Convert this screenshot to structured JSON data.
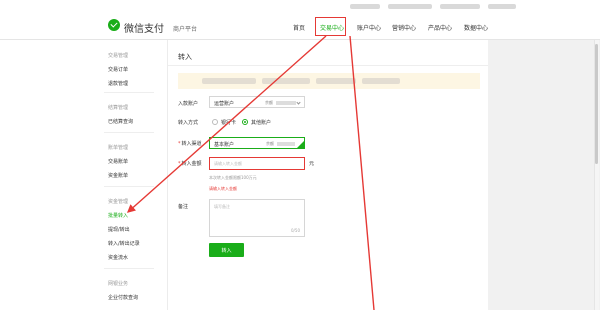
{
  "header": {
    "brand": "微信支付",
    "merchant": "商户平台",
    "nav": [
      {
        "label": "首页",
        "active": false
      },
      {
        "label": "交易中心",
        "active": true
      },
      {
        "label": "账户中心",
        "active": false
      },
      {
        "label": "营销中心",
        "active": false
      },
      {
        "label": "产品中心",
        "active": false
      },
      {
        "label": "数据中心",
        "active": false
      }
    ]
  },
  "sidebar": {
    "groups": [
      {
        "title": "交易管理",
        "items": [
          "交易订单",
          "退款管理"
        ]
      },
      {
        "title": "结算管理",
        "items": [
          "已结算查询"
        ]
      },
      {
        "title": "账单管理",
        "items": [
          "交易账单",
          "资金账单"
        ]
      },
      {
        "title": "资金管理",
        "items": [
          "批量转入",
          "提现/转出",
          "转入/转出记录",
          "资金流水"
        ]
      },
      {
        "title": "网银业务",
        "items": [
          "企业付款查询"
        ]
      }
    ],
    "active_item": "批量转入"
  },
  "form": {
    "page_title": "转入",
    "account_label": "入款账户",
    "account_value": "运营账户",
    "account_balance_label": "余额",
    "method_label": "转入方式",
    "method_options": [
      {
        "label": "银行卡",
        "selected": false
      },
      {
        "label": "其他账户",
        "selected": true
      }
    ],
    "channel_label": "转入渠道",
    "channel_value": "基本账户",
    "channel_balance_label": "余额",
    "amount_label": "转入金额",
    "amount_placeholder": "请输入转入金额",
    "amount_unit": "元",
    "amount_hint": "本次转入金额限额100万元",
    "amount_error": "请输入转入金额",
    "remark_label": "备注",
    "remark_placeholder": "填写备注",
    "remark_counter": "0/50",
    "submit_label": "转入"
  },
  "colors": {
    "accent": "#1aad19",
    "annotation": "#e53935"
  }
}
